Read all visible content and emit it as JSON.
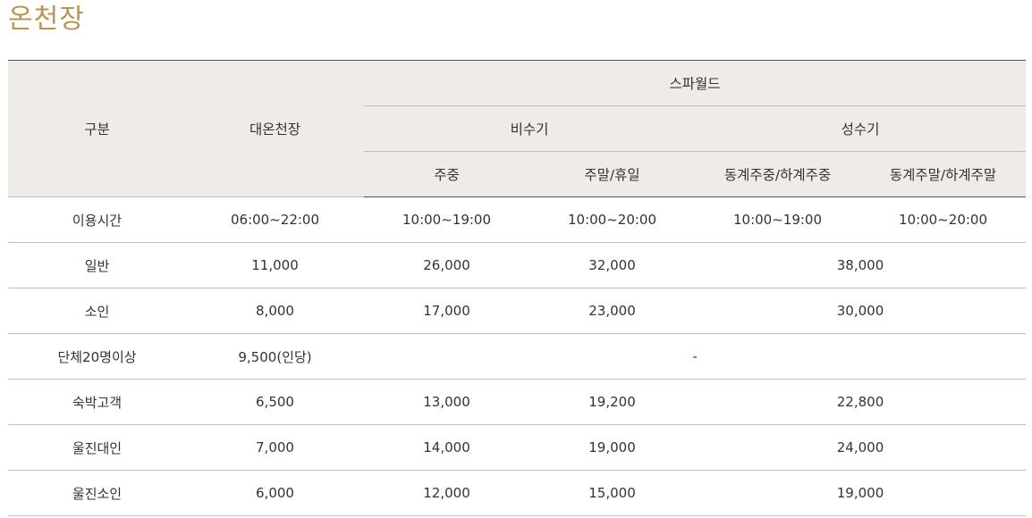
{
  "page": {
    "title": "온천장"
  },
  "table": {
    "headers": {
      "category": "구분",
      "daeon": "대온천장",
      "spaworld": "스파월드",
      "offseason": "비수기",
      "peakseason": "성수기",
      "weekday": "주중",
      "weekend_holiday": "주말/휴일",
      "winter_summer_weekday": "동계주중/하계주중",
      "winter_summer_weekend": "동계주말/하계주말"
    },
    "rows": [
      {
        "label": "이용시간",
        "daeon": "06:00~22:00",
        "off_weekday": "10:00~19:00",
        "off_weekend": "10:00~20:00",
        "peak_weekday": "10:00~19:00",
        "peak_weekend": "10:00~20:00"
      },
      {
        "label": "일반",
        "daeon": "11,000",
        "off_weekday": "26,000",
        "off_weekend": "32,000",
        "peak": "38,000"
      },
      {
        "label": "소인",
        "daeon": "8,000",
        "off_weekday": "17,000",
        "off_weekend": "23,000",
        "peak": "30,000"
      },
      {
        "label": "단체20명이상",
        "daeon": "9,500(인당)",
        "spaworld": "-"
      },
      {
        "label": "숙박고객",
        "daeon": "6,500",
        "off_weekday": "13,000",
        "off_weekend": "19,200",
        "peak": "22,800"
      },
      {
        "label": "울진대인",
        "daeon": "7,000",
        "off_weekday": "14,000",
        "off_weekend": "19,000",
        "peak": "24,000"
      },
      {
        "label": "울진소인",
        "daeon": "6,000",
        "off_weekday": "12,000",
        "off_weekend": "15,000",
        "peak": "19,000"
      }
    ]
  },
  "colors": {
    "title": "#b89457",
    "header_bg": "#efebe6",
    "border_dark": "#555555",
    "border_light": "#bdbdbd"
  }
}
